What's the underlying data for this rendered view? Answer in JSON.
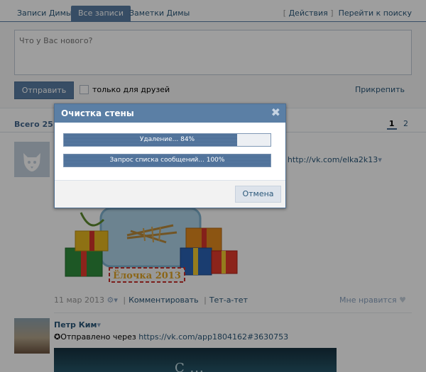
{
  "tabs": {
    "items": [
      "Записи Димы",
      "Все записи",
      "Заметки Димы"
    ],
    "actions_bracket_open": "[",
    "actions_label": "Действия",
    "actions_bracket_close": "]",
    "search_link": "Перейти к поиску"
  },
  "composer": {
    "placeholder": "Что у Вас нового?",
    "send_label": "Отправить",
    "friends_only_label": "только для друзей",
    "attach_label": "Прикрепить"
  },
  "wall": {
    "count_text": "Всего 25 з",
    "pages": [
      "1",
      "2"
    ]
  },
  "post1": {
    "text_tail": "!",
    "link": "http://vk.com/elka2k13",
    "date": "11 мар 2013",
    "comment_label": "Комментировать",
    "dialog_label": "Тет-а-тет",
    "like_label": "Мне нравится",
    "image_caption": "Ёлочка 2013"
  },
  "post2": {
    "author": "Петр Ким",
    "sent_via_prefix": "✪Отправлено через",
    "sent_via_link": "https://vk.com/app1804162#3630753"
  },
  "dialog": {
    "title": "Очистка стены",
    "close_glyph": "✖",
    "bar1": {
      "text": "Удаление... 84%",
      "progress": 0.84
    },
    "bar2": {
      "text": "Запрос списка сообщений... 100%",
      "progress": 1.0
    },
    "cancel_label": "Отмена"
  },
  "colors": {
    "accent": "#597da3",
    "link": "#2b587a",
    "dialog_header": "#5b7fa5"
  }
}
